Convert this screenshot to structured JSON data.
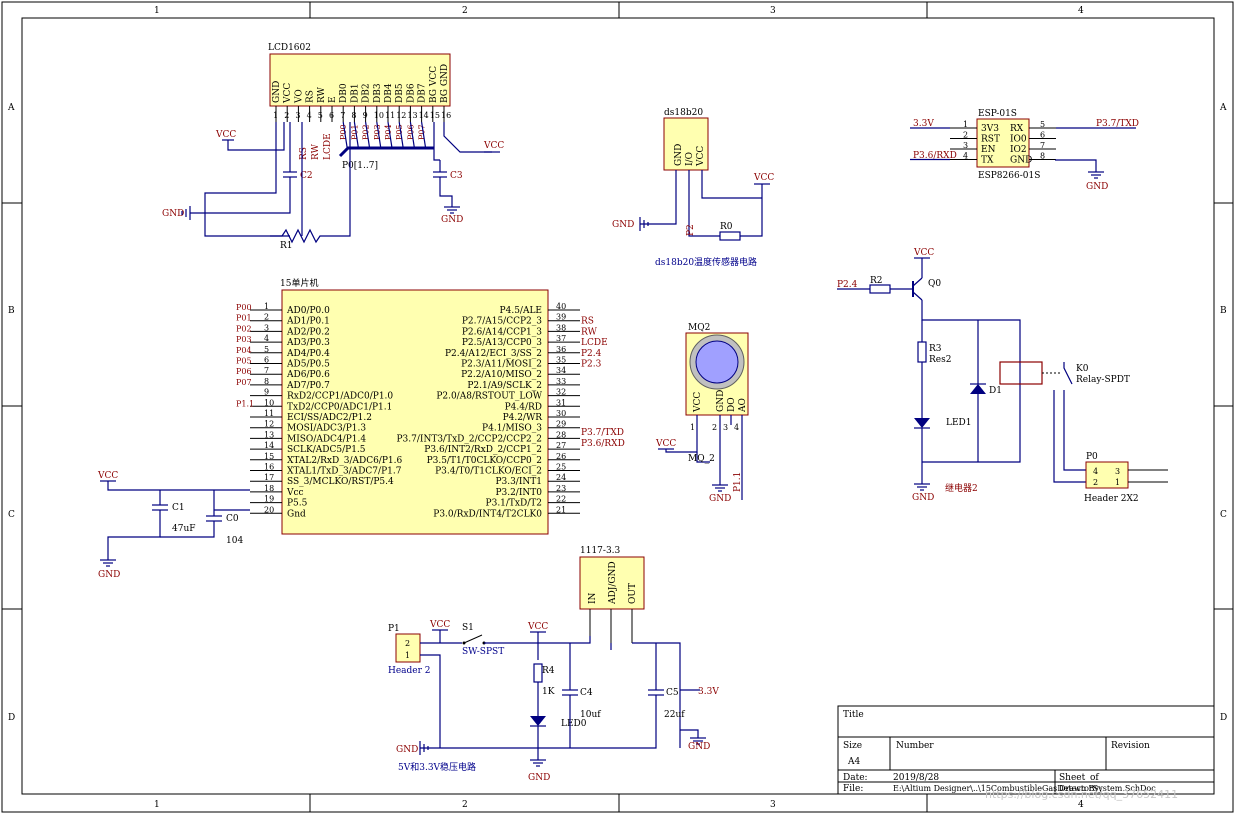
{
  "border": {
    "cols": [
      "1",
      "2",
      "3",
      "4"
    ],
    "rows": [
      "A",
      "B",
      "C",
      "D"
    ]
  },
  "lcd": {
    "title": "LCD1602",
    "pins": [
      "GND",
      "VCC",
      "VO",
      "RS",
      "RW",
      "E",
      "DB0",
      "DB1",
      "DB2",
      "DB3",
      "DB4",
      "DB5",
      "DB6",
      "DB7",
      "BG VCC",
      "BG GND"
    ],
    "pin_nums": [
      "1",
      "2",
      "3",
      "4",
      "5",
      "6",
      "7",
      "8",
      "9",
      "10",
      "11",
      "12",
      "13",
      "14",
      "15",
      "16"
    ],
    "pnets": [
      "P00",
      "P01",
      "P02",
      "P03",
      "P04",
      "P05",
      "P06",
      "P07"
    ],
    "rs": "RS",
    "rw": "RW",
    "lcde": "LCDE",
    "bus": "P0[1..7]",
    "c2": "C2",
    "c3": "C3",
    "r1": "R1",
    "vcc1": "VCC",
    "vcc2": "VCC",
    "gnd1": "GND",
    "gnd2": "GND"
  },
  "ds18b20": {
    "title": "ds18b20",
    "pins": [
      "GND",
      "I/O",
      "VCC"
    ],
    "pin_nums": [
      "1",
      "2",
      "3"
    ],
    "r0": "R0",
    "p": "P2",
    "vcc": "VCC",
    "gnd": "GND",
    "caption": "ds18b20温度传感器电路"
  },
  "esp": {
    "title": "ESP-01S",
    "left_pins": [
      "3V3",
      "RST",
      "EN",
      "TX"
    ],
    "right_pins": [
      "RX",
      "IO0",
      "IO2",
      "GND"
    ],
    "left_nums": [
      "1",
      "2",
      "3",
      "4"
    ],
    "right_nums": [
      "5",
      "6",
      "7",
      "8"
    ],
    "net_33": "3.3V",
    "net_rxd": "P3.6/RXD",
    "net_txd": "P3.7/TXD",
    "part": "ESP8266-01S",
    "gnd": "GND"
  },
  "mcu": {
    "title": "15单片机",
    "left_pins": [
      "AD0/P0.0",
      "AD1/P0.1",
      "AD2/P0.2",
      "AD3/P0.3",
      "AD4/P0.4",
      "AD5/P0.5",
      "AD6/P0.6",
      "AD7/P0.7",
      "RxD2/CCP1/ADC0/P1.0",
      "TxD2/CCP0/ADC1/P1.1",
      "ECI/SS/ADC2/P1.2",
      "MOSI/ADC3/P1.3",
      "MISO/ADC4/P1.4",
      "SCLK/ADC5/P1.5",
      "XTAL2/RxD_3/ADC6/P1.6",
      "XTAL1/TxD_3/ADC7/P1.7",
      "SS_3/MCLKO/RST/P5.4",
      "Vcc",
      "P5.5",
      "Gnd"
    ],
    "left_nums": [
      "1",
      "2",
      "3",
      "4",
      "5",
      "6",
      "7",
      "8",
      "9",
      "10",
      "11",
      "12",
      "13",
      "14",
      "15",
      "16",
      "17",
      "18",
      "19",
      "20"
    ],
    "right_pins": [
      "P4.5/ALE",
      "P2.7/A15/CCP2_3",
      "P2.6/A14/CCP1_3",
      "P2.5/A13/CCP0_3",
      "P2.4/A12/ECI_3/SS_2",
      "P2.3/A11/MOSI_2",
      "P2.2/A10/MISO_2",
      "P2.1/A9/SCLK_2",
      "P2.0/A8/RSTOUT_LOW",
      "P4.4/RD",
      "P4.2/WR",
      "P4.1/MISO_3",
      "P3.7/INT3/TxD_2/CCP2/CCP2_2",
      "P3.6/INT2/RxD_2/CCP1_2",
      "P3.5/T1/T0CLKO/CCP0_2",
      "P3.4/T0/T1CLKO/ECI_2",
      "P3.3/INT1",
      "P3.2/INT0",
      "P3.1/TxD/T2",
      "P3.0/RxD/INT4/T2CLK0"
    ],
    "right_nums": [
      "40",
      "39",
      "38",
      "37",
      "36",
      "35",
      "34",
      "33",
      "32",
      "31",
      "30",
      "29",
      "28",
      "27",
      "26",
      "25",
      "24",
      "23",
      "22",
      "21"
    ],
    "left_nets": [
      "P00",
      "P01",
      "P02",
      "P03",
      "P04",
      "P05",
      "P06",
      "P07",
      "P1.1"
    ],
    "right_nets": [
      "RS",
      "RW",
      "LCDE",
      "P2.4",
      "P2.3"
    ],
    "net_txd": "P3.7/TXD",
    "net_rxd": "P3.6/RXD",
    "vcc": "VCC",
    "gnd": "GND",
    "c1": "C1",
    "c1v": "47uF",
    "c0": "C0",
    "c0v": "104"
  },
  "mq2": {
    "title": "MQ2",
    "pins": [
      "VCC",
      "GND",
      "DO",
      "AO"
    ],
    "pin_nums": [
      "1",
      "2",
      "3",
      "4"
    ],
    "net": "MQ_2",
    "net2": "P1.1",
    "vcc": "VCC",
    "gnd": "GND"
  },
  "relay": {
    "p24": "P2.4",
    "r2": "R2",
    "q0": "Q0",
    "vcc": "VCC",
    "r3": "R3",
    "res2": "Res2",
    "d1": "D1",
    "led1": "LED1",
    "k0": "K0",
    "relay": "Relay-SPDT",
    "gnd": "GND",
    "caption": "继电器2",
    "p0": "P0",
    "hdr": "Header 2X2",
    "hdr_nums": [
      "4",
      "3",
      "2",
      "1"
    ]
  },
  "power": {
    "p1": "P1",
    "hdr": "Header 2",
    "hdr_nums": [
      "2",
      "1"
    ],
    "vcc1": "VCC",
    "s1": "S1",
    "sw": "SW-SPST",
    "vcc2": "VCC",
    "r4": "R4",
    "r4v": "1K",
    "c4": "C4",
    "c4v": "10uf",
    "led0": "LED0",
    "reg": "1117-3.3",
    "reg_pins": [
      "IN",
      "ADJ/GND",
      "OUT"
    ],
    "c5": "C5",
    "c5v": "22uf",
    "net33": "3.3V",
    "gnd1": "GND",
    "gnd2": "GND",
    "gnd3": "GND",
    "caption": "5V和3.3V稳压电路"
  },
  "title_block": {
    "title_lbl": "Title",
    "size_lbl": "Size",
    "size": "A4",
    "number_lbl": "Number",
    "revision_lbl": "Revision",
    "date_lbl": "Date:",
    "date": "2019/8/28",
    "sheet_lbl": "Sheet",
    "of_lbl": "of",
    "file_lbl": "File:",
    "file": "E:\\Altium Designer\\..\\15CombustibleGasDetectorSystem.SchDoc",
    "drawn_by": "Drawn By:"
  },
  "watermark": "https://blog.csdn.net/qq_37652411"
}
